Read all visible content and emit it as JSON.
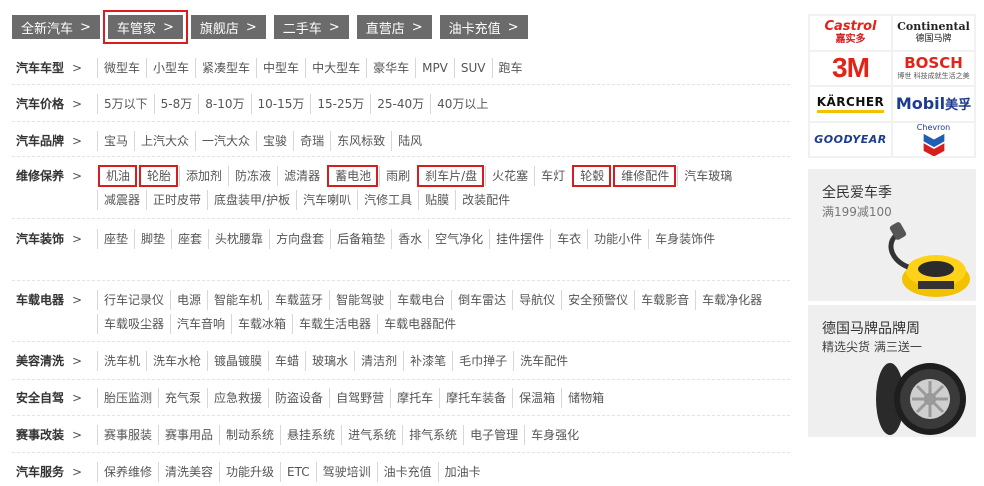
{
  "tabs": [
    {
      "label": "全新汽车",
      "highlighted": false
    },
    {
      "label": "车管家",
      "highlighted": true
    },
    {
      "label": "旗舰店",
      "highlighted": false
    },
    {
      "label": "二手车",
      "highlighted": false
    },
    {
      "label": "直营店",
      "highlighted": false
    },
    {
      "label": "油卡充值",
      "highlighted": false
    }
  ],
  "categories": [
    {
      "title": "汽车车型",
      "items": [
        {
          "label": "微型车"
        },
        {
          "label": "小型车"
        },
        {
          "label": "紧凑型车"
        },
        {
          "label": "中型车"
        },
        {
          "label": "中大型车"
        },
        {
          "label": "豪华车"
        },
        {
          "label": "MPV"
        },
        {
          "label": "SUV"
        },
        {
          "label": "跑车"
        }
      ]
    },
    {
      "title": "汽车价格",
      "items": [
        {
          "label": "5万以下"
        },
        {
          "label": "5-8万"
        },
        {
          "label": "8-10万"
        },
        {
          "label": "10-15万"
        },
        {
          "label": "15-25万"
        },
        {
          "label": "25-40万"
        },
        {
          "label": "40万以上"
        }
      ]
    },
    {
      "title": "汽车品牌",
      "items": [
        {
          "label": "宝马"
        },
        {
          "label": "上汽大众"
        },
        {
          "label": "一汽大众"
        },
        {
          "label": "宝骏"
        },
        {
          "label": "奇瑞"
        },
        {
          "label": "东风标致"
        },
        {
          "label": "陆风"
        }
      ]
    },
    {
      "title": "维修保养",
      "items": [
        {
          "label": "机油",
          "highlighted": true
        },
        {
          "label": "轮胎",
          "highlighted": true
        },
        {
          "label": "添加剂"
        },
        {
          "label": "防冻液"
        },
        {
          "label": "滤清器"
        },
        {
          "label": "蓄电池",
          "highlighted": true
        },
        {
          "label": "雨刷"
        },
        {
          "label": "刹车片/盘",
          "highlighted": true
        },
        {
          "label": "火花塞"
        },
        {
          "label": "车灯"
        },
        {
          "label": "轮毂",
          "highlighted": true
        },
        {
          "label": "维修配件",
          "highlighted": true
        },
        {
          "label": "汽车玻璃"
        },
        {
          "label": "减震器"
        },
        {
          "label": "正时皮带"
        },
        {
          "label": "底盘装甲/护板"
        },
        {
          "label": "汽车喇叭"
        },
        {
          "label": "汽修工具"
        },
        {
          "label": "贴膜"
        },
        {
          "label": "改装配件"
        }
      ]
    },
    {
      "title": "汽车装饰",
      "items": [
        {
          "label": "座垫"
        },
        {
          "label": "脚垫"
        },
        {
          "label": "座套"
        },
        {
          "label": "头枕腰靠"
        },
        {
          "label": "方向盘套"
        },
        {
          "label": "后备箱垫"
        },
        {
          "label": "香水"
        },
        {
          "label": "空气净化"
        },
        {
          "label": "挂件摆件"
        },
        {
          "label": "车衣"
        },
        {
          "label": "功能小件"
        },
        {
          "label": "车身装饰件"
        }
      ]
    },
    {
      "title": "车载电器",
      "items": [
        {
          "label": "行车记录仪"
        },
        {
          "label": "电源"
        },
        {
          "label": "智能车机"
        },
        {
          "label": "车载蓝牙"
        },
        {
          "label": "智能驾驶"
        },
        {
          "label": "车载电台"
        },
        {
          "label": "倒车雷达"
        },
        {
          "label": "导航仪"
        },
        {
          "label": "安全预警仪"
        },
        {
          "label": "车载影音"
        },
        {
          "label": "车载净化器"
        },
        {
          "label": "车载吸尘器"
        },
        {
          "label": "汽车音响"
        },
        {
          "label": "车载冰箱"
        },
        {
          "label": "车载生活电器"
        },
        {
          "label": "车载电器配件"
        }
      ]
    },
    {
      "title": "美容清洗",
      "items": [
        {
          "label": "洗车机"
        },
        {
          "label": "洗车水枪"
        },
        {
          "label": "镀晶镀膜"
        },
        {
          "label": "车蜡"
        },
        {
          "label": "玻璃水"
        },
        {
          "label": "清洁剂"
        },
        {
          "label": "补漆笔"
        },
        {
          "label": "毛巾掸子"
        },
        {
          "label": "洗车配件"
        }
      ]
    },
    {
      "title": "安全自驾",
      "items": [
        {
          "label": "胎压监测"
        },
        {
          "label": "充气泵"
        },
        {
          "label": "应急救援"
        },
        {
          "label": "防盗设备"
        },
        {
          "label": "自驾野营"
        },
        {
          "label": "摩托车"
        },
        {
          "label": "摩托车装备"
        },
        {
          "label": "保温箱"
        },
        {
          "label": "储物箱"
        }
      ]
    },
    {
      "title": "赛事改装",
      "items": [
        {
          "label": "赛事服装"
        },
        {
          "label": "赛事用品"
        },
        {
          "label": "制动系统"
        },
        {
          "label": "悬挂系统"
        },
        {
          "label": "进气系统"
        },
        {
          "label": "排气系统"
        },
        {
          "label": "电子管理"
        },
        {
          "label": "车身强化"
        }
      ]
    },
    {
      "title": "汽车服务",
      "items": [
        {
          "label": "保养维修"
        },
        {
          "label": "清洗美容"
        },
        {
          "label": "功能升级"
        },
        {
          "label": "ETC"
        },
        {
          "label": "驾驶培训"
        },
        {
          "label": "油卡充值"
        },
        {
          "label": "加油卡"
        }
      ]
    }
  ],
  "brands": {
    "castrol": {
      "line1": "Castrol",
      "line2": "嘉实多"
    },
    "continental": {
      "line1": "Continental",
      "line2": "德国马牌"
    },
    "threem": {
      "label": "3M"
    },
    "bosch": {
      "line1": "BOSCH",
      "line2": "博世 科技成就生活之美"
    },
    "karcher": {
      "label": "KÄRCHER"
    },
    "mobil": {
      "m1": "Mobil",
      "m2": "美孚"
    },
    "goodyear": {
      "label": "GOODYEAR"
    },
    "chevron": {
      "label": "Chevron"
    }
  },
  "promos": [
    {
      "title": "全民爱车季",
      "subtitle": "满199减100",
      "image": "car-vacuum-image"
    },
    {
      "title": "德国马牌品牌周",
      "subtitle": "精选尖货  满三送一",
      "image": "tire-image"
    }
  ],
  "chevron_glyph": ">",
  "colors": {
    "tab_bg": "#6b6b6b",
    "highlight_red": "#d61e1e"
  }
}
